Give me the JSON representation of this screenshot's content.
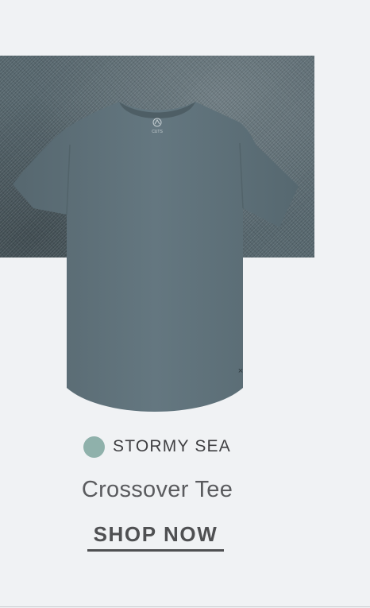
{
  "product": {
    "color_name": "STORMY SEA",
    "swatch_color": "#8fb1ab",
    "name": "Crossover Tee",
    "cta_label": "SHOP NOW",
    "logo_text": "CUTS",
    "shirt_color": "#5e7079"
  }
}
